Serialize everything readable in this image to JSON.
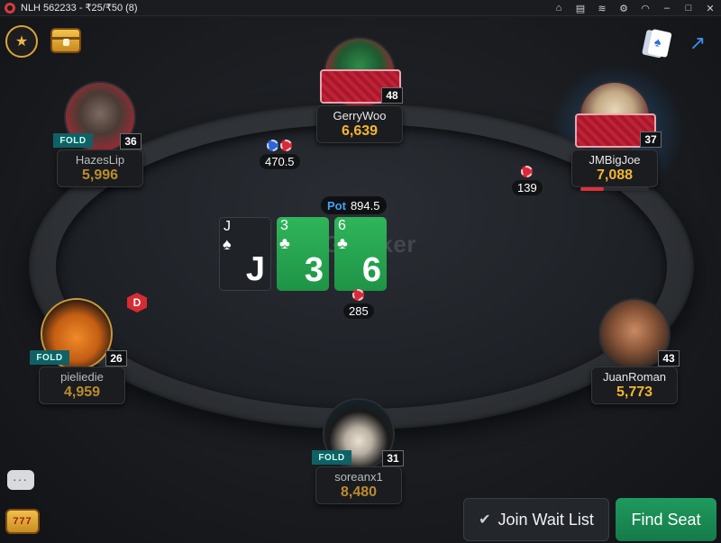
{
  "window": {
    "title": "NLH 562233 - ₹25/₹50 (8)",
    "controls": [
      "home-icon",
      "notes-icon",
      "layers-icon",
      "settings-icon",
      "wifi-icon",
      "minimize-icon",
      "maximize-icon",
      "close-icon"
    ]
  },
  "table": {
    "logo": "GG Poker",
    "pot_label": "Pot",
    "pot_amount": "894.5",
    "board": [
      {
        "rank": "J",
        "suit": "♠",
        "color": "dark"
      },
      {
        "rank": "3",
        "suit": "♣",
        "color": "green"
      },
      {
        "rank": "6",
        "suit": "♣",
        "color": "green"
      }
    ],
    "bets": [
      {
        "player": "GerryWoo",
        "amount": "470.5"
      },
      {
        "player": "JMBigJoe",
        "amount": "139"
      },
      {
        "player": "center",
        "amount": "285"
      }
    ],
    "dealer_label": "D"
  },
  "seats": [
    {
      "name": "GerryWoo",
      "stack": "6,639",
      "level": "48",
      "status": "",
      "avatar": "green-avatar"
    },
    {
      "name": "JMBigJoe",
      "stack": "7,088",
      "level": "37",
      "status": "",
      "avatar": "skull-avatar",
      "acting": true,
      "timer_fraction": 0.34
    },
    {
      "name": "HazesLip",
      "stack": "5,996",
      "level": "36",
      "status": "FOLD",
      "avatar": "wolf-avatar"
    },
    {
      "name": "pieliedie",
      "stack": "4,959",
      "level": "26",
      "status": "FOLD",
      "avatar": "pumpkin-avatar"
    },
    {
      "name": "JuanRoman",
      "stack": "5,773",
      "level": "43",
      "status": "",
      "avatar": "samurai-avatar"
    },
    {
      "name": "soreanx1",
      "stack": "8,480",
      "level": "31",
      "status": "FOLD",
      "avatar": "hat-avatar"
    }
  ],
  "actions": {
    "join_wait_list": "Join Wait List",
    "find_seat": "Find Seat"
  },
  "colors": {
    "accent_green": "#1f9a5e",
    "stack_gold": "#f2b632",
    "pot_blue": "#3fa3ff",
    "fold_teal": "#0f6166"
  }
}
